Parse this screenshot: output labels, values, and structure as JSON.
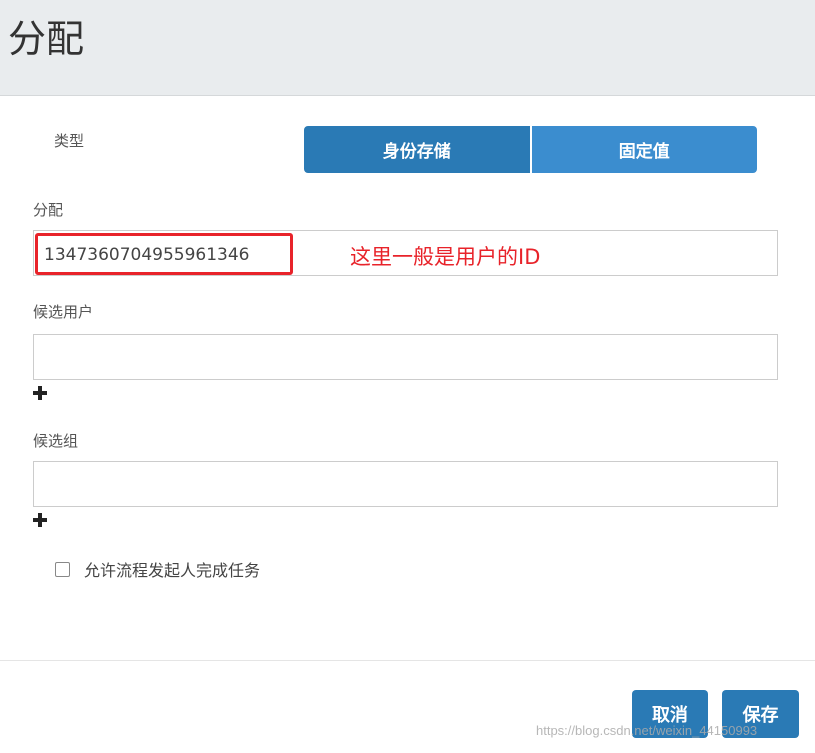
{
  "header": {
    "title": "分配"
  },
  "form": {
    "type_label": "类型",
    "type_options": [
      "身份存储",
      "固定值"
    ],
    "assignee_label": "分配",
    "assignee_value": "1347360704955961346",
    "annotation": "这里一般是用户的ID",
    "candidate_users_label": "候选用户",
    "candidate_users_value": "",
    "candidate_groups_label": "候选组",
    "candidate_groups_value": "",
    "initiator_checkbox_label": "允许流程发起人完成任务",
    "initiator_checked": false
  },
  "footer": {
    "cancel_label": "取消",
    "save_label": "保存"
  },
  "watermark": "https://blog.csdn.net/weixin_44150993",
  "colors": {
    "primary": "#2a7ab5",
    "toggle_secondary": "#3b8dcf",
    "annotation_red": "#e8232a",
    "header_bg": "#e9ecee"
  },
  "icons": [
    "plus-icon",
    "checkbox-icon"
  ]
}
